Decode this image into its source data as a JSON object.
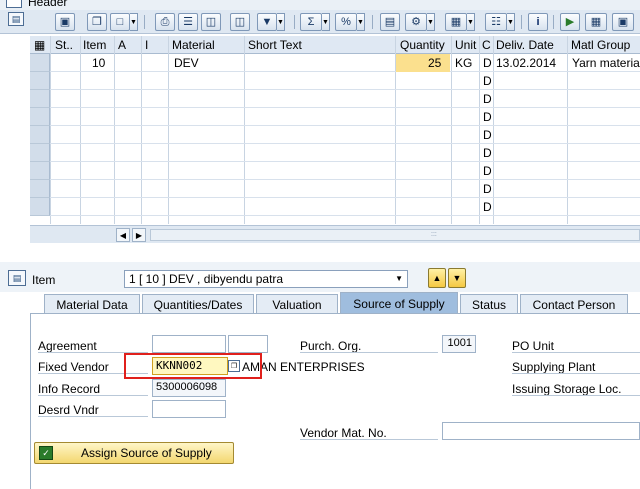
{
  "header": {
    "title": "Header"
  },
  "toolbar": {
    "icons": [
      "details-icon",
      "copy-icon",
      "delete-icon",
      "print-icon",
      "filter-icon",
      "find-icon",
      "find-next-icon",
      "set-filter-icon",
      "sum-icon",
      "subtotal-icon",
      "export-icon",
      "layout-icon",
      "select-layout-icon",
      "columns-icon",
      "info-icon",
      "transfer-icon",
      "hierarchy-icon",
      "settings-icon"
    ]
  },
  "grid": {
    "columns": [
      "St..",
      "Item",
      "A",
      "I",
      "Material",
      "Short Text",
      "Quantity",
      "Unit",
      "C",
      "Deliv. Date",
      "Matl Group"
    ],
    "rows": [
      {
        "item": "10",
        "material": "DEV",
        "short_text": "",
        "quantity": "25",
        "unit": "KG",
        "c": "D",
        "deliv_date": "13.02.2014",
        "matl_group": "Yarn materia"
      }
    ],
    "empty_row_c": "D"
  },
  "item_selector": {
    "label": "Item",
    "selected": "1 [ 10 ] DEV , dibyendu patra"
  },
  "tabs": [
    {
      "label": "Material Data",
      "active": false
    },
    {
      "label": "Quantities/Dates",
      "active": false
    },
    {
      "label": "Valuation",
      "active": false
    },
    {
      "label": "Source of Supply",
      "active": true
    },
    {
      "label": "Status",
      "active": false
    },
    {
      "label": "Contact Person",
      "active": false
    }
  ],
  "source_of_supply": {
    "agreement_label": "Agreement",
    "agreement_value": "",
    "agreement_item": "",
    "fixed_vendor_label": "Fixed Vendor",
    "fixed_vendor_value": "KKNN002",
    "fixed_vendor_name": "AMAN ENTERPRISES",
    "info_record_label": "Info Record",
    "info_record_value": "5300006098",
    "desrd_vndr_label": "Desrd Vndr",
    "desrd_vndr_value": "",
    "purch_org_label": "Purch. Org.",
    "purch_org_value": "1001",
    "po_unit_label": "PO Unit",
    "supplying_plant_label": "Supplying Plant",
    "issuing_storage_label": "Issuing Storage Loc.",
    "vendor_mat_label": "Vendor Mat. No.",
    "vendor_mat_value": "",
    "assign_button": "Assign Source of Supply"
  },
  "colors": {
    "highlight": "#e0201c",
    "quantity_fill": "#fbe08e",
    "active_tab": "#9fbdde"
  }
}
